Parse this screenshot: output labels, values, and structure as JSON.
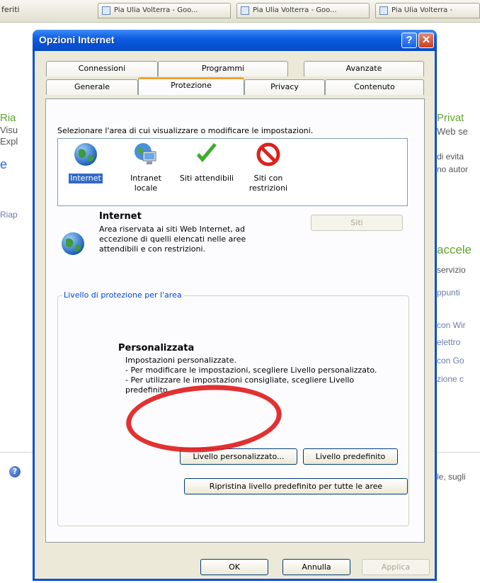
{
  "background": {
    "favorites_label": "feriti",
    "tab1": "Pia Ulia Volterra - Goo...",
    "tab2": "Pia Ulia Volterra - Goo...",
    "tab3": "Pia Ulia Volterra -",
    "left_lines": [
      "Ria",
      "Visu",
      "Expl",
      "Riap"
    ],
    "right_lines": [
      "Privat",
      "Web se",
      "di evita",
      "no autor",
      "accele",
      "servizio",
      "ppunti",
      "con Wir",
      "elettro",
      "con Go",
      "zione c",
      "le, sugli"
    ]
  },
  "dialog": {
    "title": "Opzioni Internet",
    "help_btn": "?",
    "close_btn": "✕",
    "tabs_top": [
      "Connessioni",
      "Programmi",
      "Avanzate"
    ],
    "tabs_bottom": [
      "Generale",
      "Protezione",
      "Privacy",
      "Contenuto"
    ],
    "select_label": "Selezionare l'area di cui visualizzare o modificare le impostazioni.",
    "zones": [
      {
        "label": "Internet",
        "icon": "globe-icon"
      },
      {
        "label": "Intranet locale",
        "icon": "network-computer-icon"
      },
      {
        "label": "Siti attendibili",
        "icon": "checkmark-icon"
      },
      {
        "label": "Siti con restrizioni",
        "icon": "no-entry-icon"
      }
    ],
    "zone_title": "Internet",
    "zone_description": "Area riservata ai siti Web Internet, ad eccezione di quelli elencati nelle aree attendibili e con restrizioni.",
    "sites_button": "Siti",
    "group_label": "Livello di protezione per l'area",
    "level_name": "Personalizzata",
    "level_lines": [
      "Impostazioni personalizzate.",
      "- Per modificare le impostazioni, scegliere Livello personalizzato.",
      "- Per utilizzare le impostazioni consigliate, scegliere Livello predefinito."
    ],
    "custom_level_button": "Livello personalizzato...",
    "default_level_button": "Livello predefinito",
    "reset_all_button": "Ripristina livello predefinito per tutte le aree",
    "ok_button": "OK",
    "cancel_button": "Annulla",
    "apply_button": "Applica"
  },
  "colors": {
    "titlebar": "#0553d6",
    "dialog_face": "#ece9d8",
    "selection": "#316ac5",
    "highlight_ellipse": "#e02020",
    "group_label": "#0046d5"
  }
}
